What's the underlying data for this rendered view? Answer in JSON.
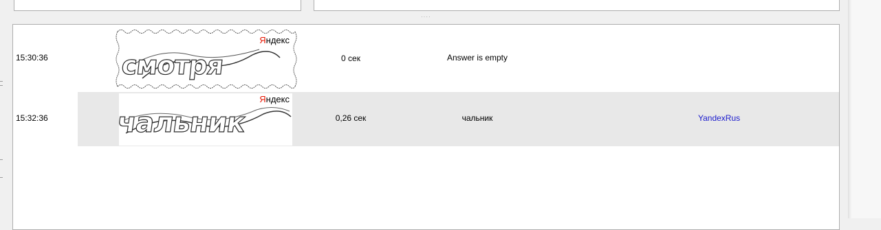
{
  "splitter": {
    "grip": "····"
  },
  "log": {
    "rows": [
      {
        "time": "15:30:36",
        "captcha": {
          "brand_first": "Я",
          "brand_rest": "ндекс",
          "word": "смотря"
        },
        "duration": "0 сек",
        "answer": "Answer is empty",
        "service": ""
      },
      {
        "time": "15:32:36",
        "captcha": {
          "brand_first": "Я",
          "brand_rest": "ндекс",
          "word": "чальник"
        },
        "duration": "0,26 сек",
        "answer": "чальник",
        "service": "YandexRus"
      }
    ]
  },
  "colors": {
    "service_link": "#1a1acd",
    "selected_row": "#e8e8e8",
    "progress_line": "#4aa34a",
    "brand_red": "#e61400"
  }
}
